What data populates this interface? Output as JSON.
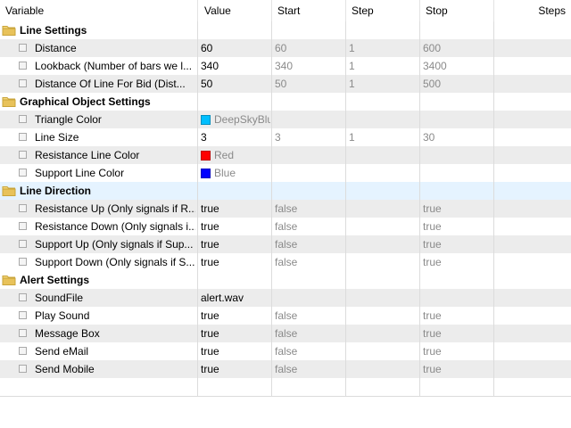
{
  "columns": {
    "variable": "Variable",
    "value": "Value",
    "start": "Start",
    "step": "Step",
    "stop": "Stop",
    "steps": "Steps"
  },
  "groups": [
    {
      "title": "Line Settings",
      "selected": false,
      "rows": [
        {
          "name": "Distance",
          "value": "60",
          "start": "60",
          "step": "1",
          "stop": "600"
        },
        {
          "name": "Lookback (Number of bars we l...",
          "value": "340",
          "start": "340",
          "step": "1",
          "stop": "3400"
        },
        {
          "name": "Distance Of Line For Bid      (Dist...",
          "value": "50",
          "start": "50",
          "step": "1",
          "stop": "500"
        }
      ]
    },
    {
      "title": "Graphical Object Settings",
      "selected": false,
      "rows": [
        {
          "name": "Triangle Color",
          "value": "DeepSkyBlue",
          "color": "#00bfff",
          "start": "",
          "step": "",
          "stop": ""
        },
        {
          "name": "Line Size",
          "value": "3",
          "start": "3",
          "step": "1",
          "stop": "30"
        },
        {
          "name": "Resistance Line Color",
          "value": "Red",
          "color": "#ff0000",
          "start": "",
          "step": "",
          "stop": ""
        },
        {
          "name": "Support Line Color",
          "value": "Blue",
          "color": "#0000ff",
          "start": "",
          "step": "",
          "stop": ""
        }
      ]
    },
    {
      "title": "Line Direction",
      "selected": true,
      "rows": [
        {
          "name": "Resistance Up  (Only signals if R...",
          "value": "true",
          "start": "false",
          "step": "",
          "stop": "true"
        },
        {
          "name": "Resistance Down  (Only signals i...",
          "value": "true",
          "start": "false",
          "step": "",
          "stop": "true"
        },
        {
          "name": "Support Up  (Only signals if Sup...",
          "value": "true",
          "start": "false",
          "step": "",
          "stop": "true"
        },
        {
          "name": "Support Down  (Only signals if S...",
          "value": "true",
          "start": "false",
          "step": "",
          "stop": "true"
        }
      ]
    },
    {
      "title": "Alert Settings",
      "selected": false,
      "rows": [
        {
          "name": "SoundFile",
          "value": "alert.wav",
          "start": "",
          "step": "",
          "stop": ""
        },
        {
          "name": "Play Sound",
          "value": "true",
          "start": "false",
          "step": "",
          "stop": "true"
        },
        {
          "name": "Message Box",
          "value": "true",
          "start": "false",
          "step": "",
          "stop": "true"
        },
        {
          "name": "Send eMail",
          "value": "true",
          "start": "false",
          "step": "",
          "stop": "true"
        },
        {
          "name": "Send Mobile",
          "value": "true",
          "start": "false",
          "step": "",
          "stop": "true"
        }
      ]
    }
  ],
  "colors": {
    "selected_group_bg": "#e5f3ff",
    "alt_row_bg": "#ececec",
    "muted_text": "#8a8a8a",
    "folder_yellow": "#e8c25a"
  },
  "icons": {
    "group": "folder-icon",
    "row": "checkbox-icon"
  }
}
